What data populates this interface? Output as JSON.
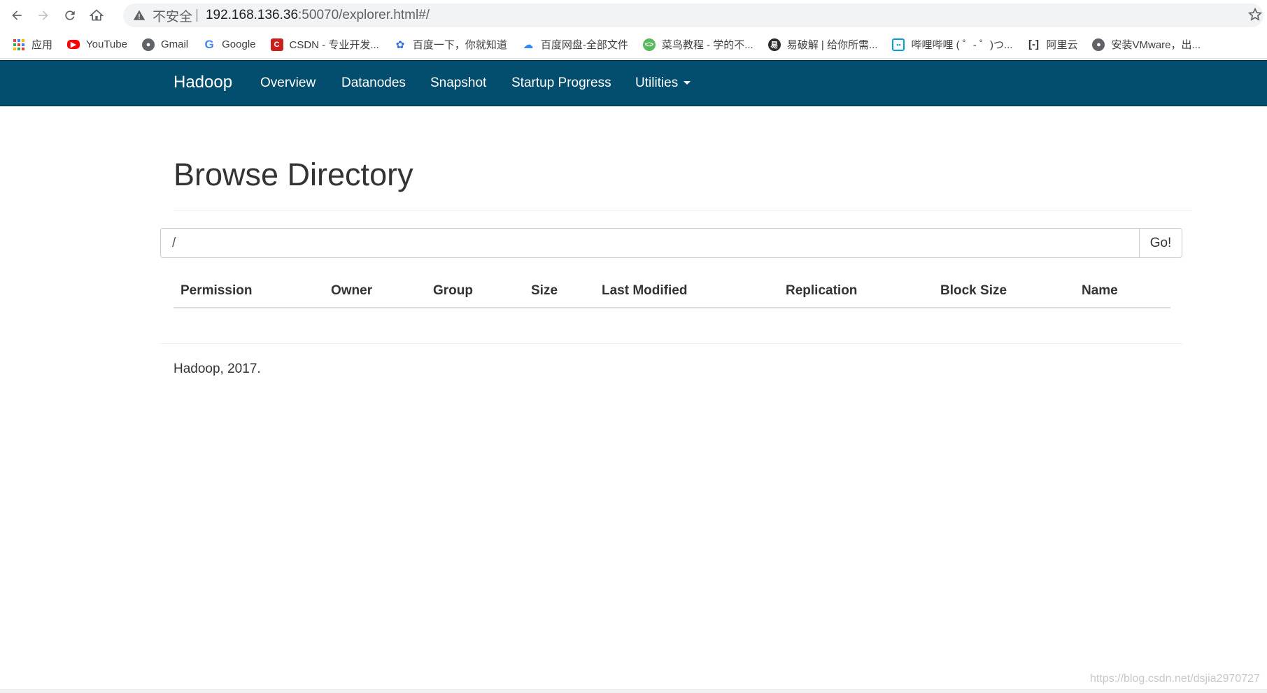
{
  "browser": {
    "address": {
      "insecure_label": "不安全",
      "separator": "|",
      "host": "192.168.136.36",
      "path": ":50070/explorer.html#/"
    },
    "bookmarks": [
      {
        "label": "应用",
        "icon": "apps-grid-icon"
      },
      {
        "label": "YouTube",
        "icon": "youtube-icon"
      },
      {
        "label": "Gmail",
        "icon": "globe-icon"
      },
      {
        "label": "Google",
        "icon": "google-icon"
      },
      {
        "label": "CSDN - 专业开发...",
        "icon": "csdn-icon"
      },
      {
        "label": "百度一下，你就知道",
        "icon": "baidu-paw-icon"
      },
      {
        "label": "百度网盘-全部文件",
        "icon": "baidu-cloud-icon"
      },
      {
        "label": "菜鸟教程 - 学的不...",
        "icon": "runoob-icon"
      },
      {
        "label": "易破解 | 给你所需...",
        "icon": "yipojie-icon"
      },
      {
        "label": "哔哩哔哩 ( ゜- ゜)つ...",
        "icon": "bilibili-tv-icon"
      },
      {
        "label": "阿里云",
        "icon": "aliyun-icon"
      },
      {
        "label": "安装VMware，出...",
        "icon": "globe-icon"
      }
    ]
  },
  "navbar": {
    "brand": "Hadoop",
    "items": [
      "Overview",
      "Datanodes",
      "Snapshot",
      "Startup Progress",
      "Utilities"
    ]
  },
  "page": {
    "title": "Browse Directory",
    "path_value": "/",
    "go_label": "Go!",
    "columns": [
      "Permission",
      "Owner",
      "Group",
      "Size",
      "Last Modified",
      "Replication",
      "Block Size",
      "Name"
    ],
    "footer": "Hadoop, 2017.",
    "watermark": "https://blog.csdn.net/dsjia2970727"
  },
  "colors": {
    "navbar": "#034d6e",
    "text": "#333333"
  }
}
